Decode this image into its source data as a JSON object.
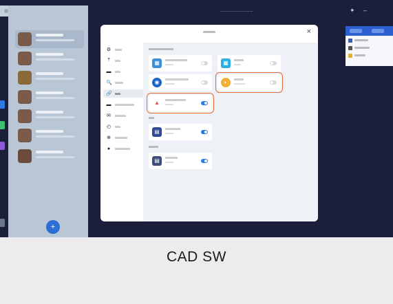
{
  "caption": "CAD SW",
  "modal": {
    "close_glyph": "×",
    "nav": [
      {
        "icon": "⚙"
      },
      {
        "icon": "⤒"
      },
      {
        "icon": "▬"
      },
      {
        "icon": "🔍"
      },
      {
        "icon": "🔗",
        "selected": true
      },
      {
        "icon": "▬"
      },
      {
        "icon": "✉"
      },
      {
        "icon": "◴"
      },
      {
        "icon": "⊕"
      },
      {
        "icon": "●"
      }
    ],
    "integrations": [
      {
        "icon_color": "#3a8fd8",
        "glyph": "▦",
        "toggle": "off"
      },
      {
        "icon_color": "#2bb0e6",
        "glyph": "▦",
        "toggle": "off"
      },
      {
        "icon_color": "#1e64c8",
        "glyph": "◉",
        "toggle": "off"
      },
      {
        "icon_color": "#f0b23a",
        "glyph": "◐",
        "toggle": "off",
        "highlighted": true
      },
      {
        "icon_color": "#e84a3a",
        "glyph": "▲",
        "toggle": "on",
        "highlighted": true
      },
      {
        "icon_color": "#2f4a8f",
        "glyph": "▤",
        "toggle": "on"
      },
      {
        "icon_color": "#3b4f7a",
        "glyph": "▤",
        "toggle": "on"
      }
    ]
  },
  "fab_glyph": "+",
  "colors": {
    "accent": "#2f7be6",
    "highlight": "#e0703a",
    "background": "#1c1f3a"
  }
}
